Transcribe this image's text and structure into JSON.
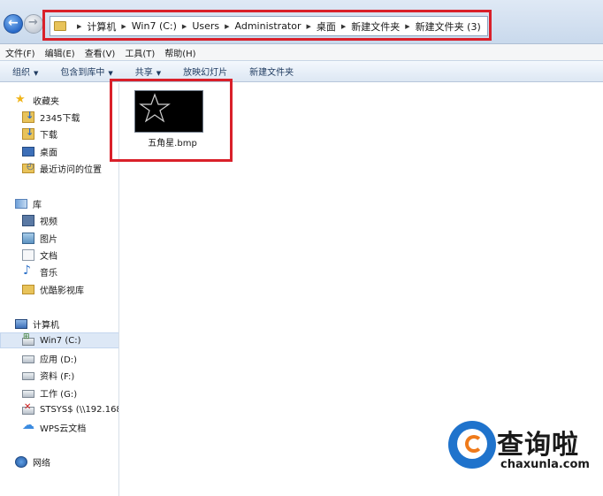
{
  "address": {
    "crumbs": [
      "计算机",
      "Win7 (C:)",
      "Users",
      "Administrator",
      "桌面",
      "新建文件夹",
      "新建文件夹 (3)"
    ]
  },
  "menubar": {
    "items": [
      "文件(F)",
      "编辑(E)",
      "查看(V)",
      "工具(T)",
      "帮助(H)"
    ]
  },
  "commandbar": {
    "items": [
      {
        "label": "组织",
        "has_caret": true
      },
      {
        "label": "包含到库中",
        "has_caret": true
      },
      {
        "label": "共享",
        "has_caret": true
      },
      {
        "label": "放映幻灯片",
        "has_caret": false
      },
      {
        "label": "新建文件夹",
        "has_caret": false
      }
    ]
  },
  "navpane": {
    "favorites": {
      "label": "收藏夹",
      "icon": "star-icon"
    },
    "favorites_items": [
      {
        "label": "2345下载",
        "icon": "download-folder-icon"
      },
      {
        "label": "下载",
        "icon": "download-folder-icon"
      },
      {
        "label": "桌面",
        "icon": "desktop-icon"
      },
      {
        "label": "最近访问的位置",
        "icon": "recent-places-icon"
      }
    ],
    "libraries": {
      "label": "库",
      "icon": "library-icon"
    },
    "library_items": [
      {
        "label": "视频",
        "icon": "video-icon"
      },
      {
        "label": "图片",
        "icon": "pictures-icon"
      },
      {
        "label": "文档",
        "icon": "documents-icon"
      },
      {
        "label": "音乐",
        "icon": "music-icon"
      },
      {
        "label": "优酷影视库",
        "icon": "folder-icon"
      }
    ],
    "computer": {
      "label": "计算机",
      "icon": "computer-icon"
    },
    "computer_items": [
      {
        "label": "Win7 (C:)",
        "icon": "system-drive-icon",
        "selected": true
      },
      {
        "label": "应用 (D:)",
        "icon": "drive-icon"
      },
      {
        "label": "资料 (F:)",
        "icon": "drive-icon"
      },
      {
        "label": "工作 (G:)",
        "icon": "drive-icon"
      },
      {
        "label": "STSYS$ (\\\\192.168",
        "icon": "network-drive-icon"
      },
      {
        "label": "WPS云文档",
        "icon": "cloud-icon"
      }
    ],
    "network": {
      "label": "网络",
      "icon": "network-icon"
    }
  },
  "content": {
    "file": {
      "name": "五角星.bmp",
      "thumbnail": "black image with outlined star"
    }
  },
  "watermark": {
    "text": "查询啦",
    "url": "chaxunla.com"
  },
  "colors": {
    "highlight_box": "#d9202a",
    "selection": "#dde8f6",
    "watermark_blue": "#1f73cc",
    "watermark_orange": "#ef7a1a"
  }
}
